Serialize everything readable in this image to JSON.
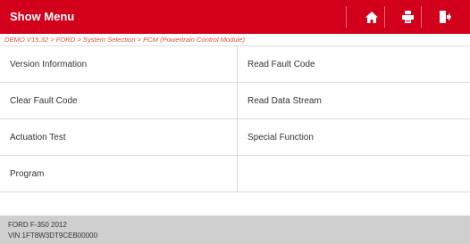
{
  "header": {
    "title": "Show Menu",
    "icons": [
      "home-icon",
      "print-icon",
      "exit-icon"
    ],
    "colors": {
      "bar": "#d3001c",
      "icon": "#ffffff"
    }
  },
  "breadcrumb": "DEMO V15.32 > FORD > System Selection > PCM (Powertrain Control Module)",
  "menu": [
    {
      "label": "Version Information"
    },
    {
      "label": "Read Fault Code"
    },
    {
      "label": "Clear Fault Code"
    },
    {
      "label": "Read Data Stream"
    },
    {
      "label": "Actuation Test"
    },
    {
      "label": "Special Function"
    },
    {
      "label": "Program"
    },
    {
      "label": ""
    }
  ],
  "footer": {
    "vehicle": "FORD F-350 2012",
    "vin": "VIN 1FT8W3DT9CEB00000"
  }
}
